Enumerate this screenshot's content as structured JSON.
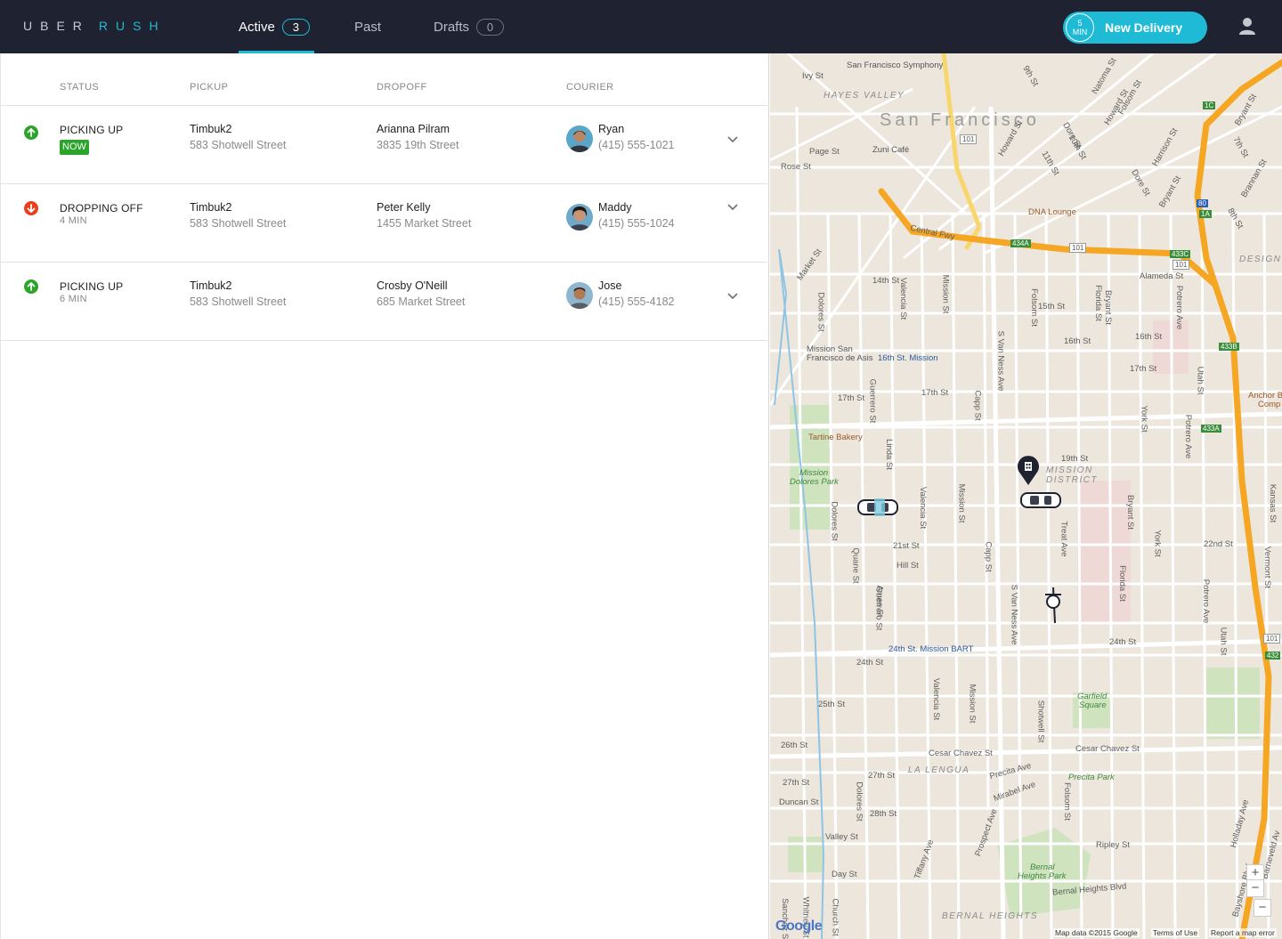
{
  "app": {
    "logo_left": "UBER",
    "logo_right": "RUSH"
  },
  "tabs": [
    {
      "label": "Active",
      "count": "3"
    },
    {
      "label": "Past"
    },
    {
      "label": "Drafts",
      "count": "0"
    }
  ],
  "new_delivery": {
    "eta_number": "5",
    "eta_unit": "MIN",
    "label": "New Delivery"
  },
  "columns": {
    "status": "STATUS",
    "pickup": "PICKUP",
    "dropoff": "DROPOFF",
    "courier": "COURIER"
  },
  "deliveries": [
    {
      "status": "PICKING UP",
      "status_sub": "NOW",
      "direction": "up",
      "pickup_name": "Timbuk2",
      "pickup_address": "583 Shotwell Street",
      "dropoff_name": "Arianna Pilram",
      "dropoff_address": "3835 19th Street",
      "courier_name": "Ryan",
      "courier_phone": "(415) 555-1021"
    },
    {
      "status": "DROPPING OFF",
      "status_sub": "4 MIN",
      "direction": "down",
      "pickup_name": "Timbuk2",
      "pickup_address": "583 Shotwell Street",
      "dropoff_name": "Peter Kelly",
      "dropoff_address": "1455 Market Street",
      "courier_name": "Maddy",
      "courier_phone": "(415) 555-1024"
    },
    {
      "status": "PICKING UP",
      "status_sub": "6 MIN",
      "direction": "up",
      "pickup_name": "Timbuk2",
      "pickup_address": "583 Shotwell Street",
      "dropoff_name": "Crosby O'Neill",
      "dropoff_address": "685 Market Street",
      "courier_name": "Jose",
      "courier_phone": "(415) 555-4182"
    }
  ],
  "colors": {
    "accent": "#1fbad6",
    "topbar": "#1f2230",
    "status_up": "#2aa52a",
    "status_down": "#e8401c",
    "freeway": "#f5a623"
  },
  "icons": {
    "status_up": "arrow-up-circle-icon",
    "status_down": "arrow-down-circle-icon",
    "expand": "chevron-down-icon",
    "profile": "user-icon",
    "pickup_marker": "building-pin-icon",
    "vehicles": [
      "car-icon",
      "car-icon",
      "bike-icon"
    ]
  },
  "map": {
    "city": "San Francisco",
    "labels": {
      "symphony": "San Francisco Symphony",
      "ivy": "Ivy St",
      "hayes": "HAYES VALLEY",
      "page": "Page St",
      "rose": "Rose St",
      "zuni": "Zuni Café",
      "central": "Central Fwy",
      "dna": "DNA Lounge",
      "market": "Market St",
      "fourteenth": "14th St",
      "fifteenth": "15th St",
      "sixteenth": "16th St",
      "sixteenth_r": "16th St",
      "seventeenth": "17th St",
      "seventeenth_r": "17th St",
      "mission_sf": "Mission San",
      "mission_sf2": "Francisco de Asis",
      "bart16": "16th St. Mission",
      "tartine": "Tartine Bakery",
      "dolores_park": "Mission",
      "dolores_park2": "Dolores Park",
      "nineteenth": "19th St",
      "mission_dist": "MISSION",
      "mission_dist2": "DISTRICT",
      "twentyfirst": "21st St",
      "hill": "Hill St",
      "twentysecond": "22nd St",
      "bart24": "24th St. Mission BART",
      "twentyfourth": "24th St",
      "twentyfourth_r": "24th St",
      "twentyfifth": "25th St",
      "twentysixth": "26th St",
      "cesar": "Cesar Chavez St",
      "cesar_r": "Cesar Chavez St",
      "lalengua": "LA LENGUA",
      "twentyseventh": "27th St",
      "twentyseventh_l": "27th St",
      "duncan": "Duncan St",
      "twentyeighth": "28th St",
      "precita": "Precita Ave",
      "precita_park": "Precita Park",
      "mirabel": "Mirabel Ave",
      "ripley": "Ripley St",
      "valley": "Valley St",
      "day": "Day St",
      "bernal_park": "Bernal",
      "bernal_park2": "Heights Park",
      "bernal_blvd": "Bernal Heights Blvd",
      "bernal": "BERNAL HEIGHTS",
      "garfield": "Garfield",
      "garfield2": "Square",
      "alameda": "Alameda St",
      "design": "DESIGN",
      "anchor": "Anchor Brew",
      "anchor2": "Comp",
      "dolores_st": "Dolores St",
      "guerrero": "Guerrero St",
      "valencia": "Valencia St",
      "mission_st": "Mission St",
      "svanness": "S Van Ness Ave",
      "capp": "Capp St",
      "folsom": "Folsom St",
      "harrison": "Harrison St",
      "bryant": "Bryant St",
      "york": "York St",
      "potrero": "Potrero Ave",
      "vermont": "Vermont St",
      "kansas": "Kansas St",
      "utah": "Utah St",
      "treat": "Treat Ave",
      "linda": "Linda St",
      "quane": "Quane St",
      "ames": "Ames St",
      "florida": "Florida St",
      "shotwell": "Shotwell St",
      "howard": "Howard St",
      "eleventh": "11th St",
      "ninth": "9th St",
      "tenth": "10th St",
      "dore": "Dore St",
      "seventh": "7th St",
      "eighth": "8th St",
      "bayshore": "Bayshore Blvd",
      "barneveld": "Barneveld Av",
      "holladay": "Holladay Ave",
      "tiffany": "Tiffany Ave",
      "prospect": "Prospect Ave",
      "church": "Church St",
      "sanchez": "Sanchez St",
      "whitney": "Whitney St",
      "natoma": "Natoma St",
      "brannan": "Brannan St",
      "erie": "Erie St"
    },
    "shields": {
      "hw101": "101",
      "hw101b": "101",
      "hw101c": "101",
      "hw80": "80",
      "i1a": "1A",
      "hw433c": "433C",
      "hw434a": "434A",
      "hw433b": "433B",
      "hw433a": "433A",
      "hw432": "432",
      "hw1c": "1C",
      "hw101d": "101"
    },
    "zoom_in": "+",
    "zoom_out": "−",
    "google": "Google",
    "footer_data": "Map data ©2015 Google",
    "footer_terms": "Terms of Use",
    "footer_report": "Report a map error"
  }
}
